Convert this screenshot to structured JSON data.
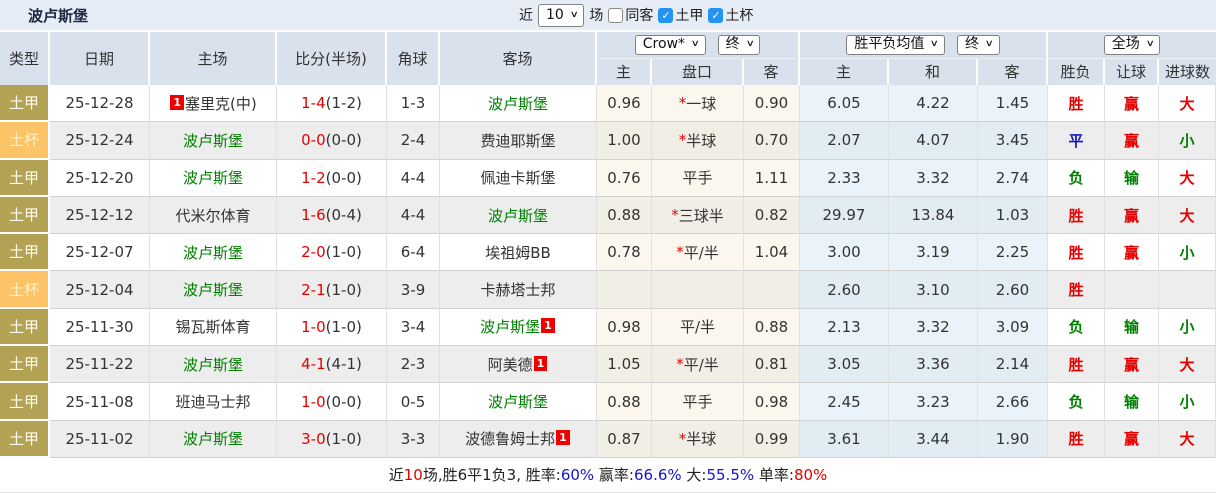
{
  "topbar": {
    "title": "波卢斯堡",
    "near_label": "近",
    "count": "10",
    "matches_label": "场",
    "filters": [
      {
        "label": "同客",
        "checked": false
      },
      {
        "label": "土甲",
        "checked": true
      },
      {
        "label": "土杯",
        "checked": true
      }
    ]
  },
  "header": {
    "type": "类型",
    "date": "日期",
    "home": "主场",
    "score": "比分(半场)",
    "corner": "角球",
    "away": "客场",
    "dropdowns": {
      "bookmaker": "Crow*",
      "asian_final": "终",
      "avg": "胜平负均值",
      "euro_final": "终",
      "scope": "全场"
    },
    "sub": {
      "asian_home": "主",
      "handicap": "盘口",
      "asian_away": "客",
      "euro_home": "主",
      "euro_draw": "和",
      "euro_away": "客",
      "outcome": "胜负",
      "handicap_result": "让球",
      "goals": "进球数"
    }
  },
  "rows": [
    {
      "type": "土甲",
      "type_style": "khaki",
      "date": "25-12-28",
      "home": {
        "name": "塞里克(中)",
        "green": false,
        "badge": "1",
        "badge_pos": "before"
      },
      "score": {
        "ft": "1-4",
        "ht": "(1-2)"
      },
      "corner": "1-3",
      "away": {
        "name": "波卢斯堡",
        "green": true
      },
      "asian": {
        "home": "0.96",
        "star": true,
        "handicap": "一球",
        "away": "0.90"
      },
      "euro": {
        "home": "6.05",
        "draw": "4.22",
        "away": "1.45"
      },
      "result": {
        "outcome": "胜",
        "outcome_c": "red",
        "let": "赢",
        "let_c": "red",
        "goal": "大",
        "goal_c": "red"
      }
    },
    {
      "type": "土杯",
      "type_style": "orange",
      "date": "25-12-24",
      "home": {
        "name": "波卢斯堡",
        "green": true
      },
      "score": {
        "ft": "0-0",
        "ht": "(0-0)"
      },
      "corner": "2-4",
      "away": {
        "name": "费迪耶斯堡",
        "green": false
      },
      "asian": {
        "home": "1.00",
        "star": true,
        "handicap": "半球",
        "away": "0.70"
      },
      "euro": {
        "home": "2.07",
        "draw": "4.07",
        "away": "3.45"
      },
      "result": {
        "outcome": "平",
        "outcome_c": "blue",
        "let": "赢",
        "let_c": "red",
        "goal": "小",
        "goal_c": "green"
      }
    },
    {
      "type": "土甲",
      "type_style": "khaki",
      "date": "25-12-20",
      "home": {
        "name": "波卢斯堡",
        "green": true
      },
      "score": {
        "ft": "1-2",
        "ht": "(0-0)"
      },
      "corner": "4-4",
      "away": {
        "name": "佩迪卡斯堡",
        "green": false
      },
      "asian": {
        "home": "0.76",
        "star": false,
        "handicap": "平手",
        "away": "1.11"
      },
      "euro": {
        "home": "2.33",
        "draw": "3.32",
        "away": "2.74"
      },
      "result": {
        "outcome": "负",
        "outcome_c": "green",
        "let": "输",
        "let_c": "green",
        "goal": "大",
        "goal_c": "red"
      }
    },
    {
      "type": "土甲",
      "type_style": "khaki",
      "date": "25-12-12",
      "home": {
        "name": "代米尔体育",
        "green": false
      },
      "score": {
        "ft": "1-6",
        "ht": "(0-4)"
      },
      "corner": "4-4",
      "away": {
        "name": "波卢斯堡",
        "green": true
      },
      "asian": {
        "home": "0.88",
        "star": true,
        "handicap": "三球半",
        "away": "0.82"
      },
      "euro": {
        "home": "29.97",
        "draw": "13.84",
        "away": "1.03"
      },
      "result": {
        "outcome": "胜",
        "outcome_c": "red",
        "let": "赢",
        "let_c": "red",
        "goal": "大",
        "goal_c": "red"
      }
    },
    {
      "type": "土甲",
      "type_style": "khaki",
      "date": "25-12-07",
      "home": {
        "name": "波卢斯堡",
        "green": true
      },
      "score": {
        "ft": "2-0",
        "ht": "(1-0)"
      },
      "corner": "6-4",
      "away": {
        "name": "埃祖姆BB",
        "green": false
      },
      "asian": {
        "home": "0.78",
        "star": true,
        "handicap": "平/半",
        "away": "1.04"
      },
      "euro": {
        "home": "3.00",
        "draw": "3.19",
        "away": "2.25"
      },
      "result": {
        "outcome": "胜",
        "outcome_c": "red",
        "let": "赢",
        "let_c": "red",
        "goal": "小",
        "goal_c": "green"
      }
    },
    {
      "type": "土杯",
      "type_style": "orange",
      "date": "25-12-04",
      "home": {
        "name": "波卢斯堡",
        "green": true
      },
      "score": {
        "ft": "2-1",
        "ht": "(1-0)"
      },
      "corner": "3-9",
      "away": {
        "name": "卡赫塔士邦",
        "green": false
      },
      "asian": {
        "home": "",
        "star": false,
        "handicap": "",
        "away": ""
      },
      "euro": {
        "home": "2.60",
        "draw": "3.10",
        "away": "2.60"
      },
      "result": {
        "outcome": "胜",
        "outcome_c": "red",
        "let": "",
        "let_c": "",
        "goal": "",
        "goal_c": ""
      }
    },
    {
      "type": "土甲",
      "type_style": "khaki",
      "date": "25-11-30",
      "home": {
        "name": "锡瓦斯体育",
        "green": false
      },
      "score": {
        "ft": "1-0",
        "ht": "(1-0)"
      },
      "corner": "3-4",
      "away": {
        "name": "波卢斯堡",
        "green": true,
        "badge": "1",
        "badge_pos": "after"
      },
      "asian": {
        "home": "0.98",
        "star": false,
        "handicap": "平/半",
        "away": "0.88"
      },
      "euro": {
        "home": "2.13",
        "draw": "3.32",
        "away": "3.09"
      },
      "result": {
        "outcome": "负",
        "outcome_c": "green",
        "let": "输",
        "let_c": "green",
        "goal": "小",
        "goal_c": "green"
      }
    },
    {
      "type": "土甲",
      "type_style": "khaki",
      "date": "25-11-22",
      "home": {
        "name": "波卢斯堡",
        "green": true
      },
      "score": {
        "ft": "4-1",
        "ht": "(4-1)"
      },
      "corner": "2-3",
      "away": {
        "name": "阿美德",
        "green": false,
        "badge": "1",
        "badge_pos": "after"
      },
      "asian": {
        "home": "1.05",
        "star": true,
        "handicap": "平/半",
        "away": "0.81"
      },
      "euro": {
        "home": "3.05",
        "draw": "3.36",
        "away": "2.14"
      },
      "result": {
        "outcome": "胜",
        "outcome_c": "red",
        "let": "赢",
        "let_c": "red",
        "goal": "大",
        "goal_c": "red"
      }
    },
    {
      "type": "土甲",
      "type_style": "khaki",
      "date": "25-11-08",
      "home": {
        "name": "班迪马士邦",
        "green": false
      },
      "score": {
        "ft": "1-0",
        "ht": "(0-0)"
      },
      "corner": "0-5",
      "away": {
        "name": "波卢斯堡",
        "green": true
      },
      "asian": {
        "home": "0.88",
        "star": false,
        "handicap": "平手",
        "away": "0.98"
      },
      "euro": {
        "home": "2.45",
        "draw": "3.23",
        "away": "2.66"
      },
      "result": {
        "outcome": "负",
        "outcome_c": "green",
        "let": "输",
        "let_c": "green",
        "goal": "小",
        "goal_c": "green"
      }
    },
    {
      "type": "土甲",
      "type_style": "khaki",
      "date": "25-11-02",
      "home": {
        "name": "波卢斯堡",
        "green": true
      },
      "score": {
        "ft": "3-0",
        "ht": "(1-0)"
      },
      "corner": "3-3",
      "away": {
        "name": "波德鲁姆士邦",
        "green": false,
        "badge": "1",
        "badge_pos": "after"
      },
      "asian": {
        "home": "0.87",
        "star": true,
        "handicap": "半球",
        "away": "0.99"
      },
      "euro": {
        "home": "3.61",
        "draw": "3.44",
        "away": "1.90"
      },
      "result": {
        "outcome": "胜",
        "outcome_c": "red",
        "let": "赢",
        "let_c": "red",
        "goal": "大",
        "goal_c": "red"
      }
    }
  ],
  "summary": {
    "segments": [
      {
        "text": "近",
        "color": ""
      },
      {
        "text": "10",
        "color": "red"
      },
      {
        "text": "场,胜6平1负3, 胜率:",
        "color": ""
      },
      {
        "text": "60%",
        "color": "blue"
      },
      {
        "text": " 赢率:",
        "color": ""
      },
      {
        "text": "66.6%",
        "color": "blue"
      },
      {
        "text": " 大:",
        "color": ""
      },
      {
        "text": "55.5%",
        "color": "blue"
      },
      {
        "text": " 单率:",
        "color": ""
      },
      {
        "text": "80%",
        "color": "red"
      }
    ]
  },
  "colors": {
    "accent_red": "#e60000",
    "accent_green": "#008000",
    "accent_blue": "#1414cc",
    "type_khaki": "#b3a253",
    "type_orange": "#fcc367",
    "header_bg": "#d9e2ec",
    "titlebar_bg": "#e7edf6"
  }
}
